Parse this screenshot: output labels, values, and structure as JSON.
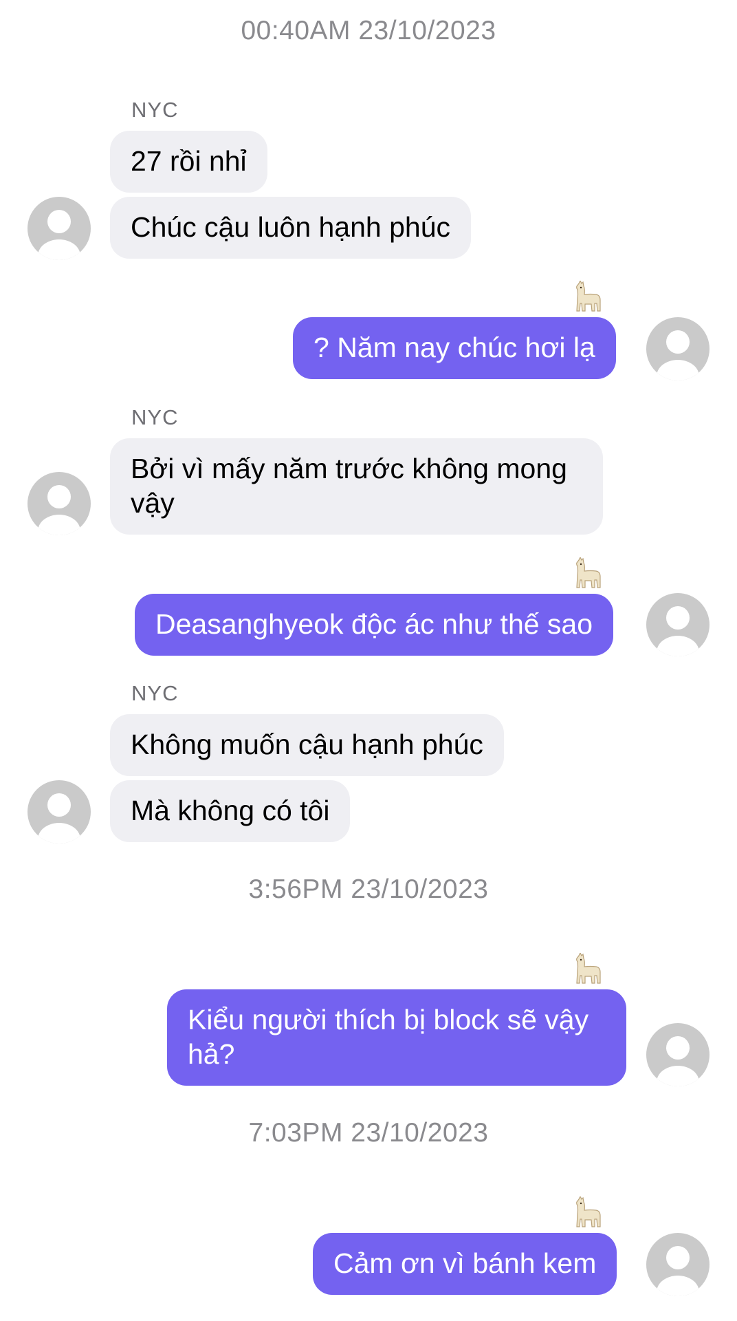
{
  "conversation": {
    "timestamps": [
      "00:40AM 23/10/2023",
      "3:56PM 23/10/2023",
      "7:03PM 23/10/2023"
    ],
    "contact_name": "NYC",
    "messages": [
      {
        "from": "contact",
        "text": "27 rồi nhỉ"
      },
      {
        "from": "contact",
        "text": "Chúc cậu luôn hạnh phúc"
      },
      {
        "from": "me",
        "text": "? Năm nay chúc hơi lạ",
        "reaction": "llama-icon"
      },
      {
        "from": "contact",
        "text": "Bởi vì mấy năm trước không mong vậy"
      },
      {
        "from": "me",
        "text": "Deasanghyeok độc ác như thế sao",
        "reaction": "llama-icon"
      },
      {
        "from": "contact",
        "text": "Không muốn cậu hạnh phúc"
      },
      {
        "from": "contact",
        "text": "Mà không có tôi"
      },
      {
        "from": "me",
        "text": "Kiểu người thích bị block sẽ vậy hả?",
        "reaction": "llama-icon"
      },
      {
        "from": "me",
        "text": "Cảm ơn vì bánh kem",
        "reaction": "llama-icon"
      }
    ]
  },
  "colors": {
    "outgoing_bubble": "#7462f0",
    "incoming_bubble": "#efeff3",
    "avatar_placeholder": "#cacaca",
    "timestamp_text": "#8a8a8e"
  }
}
